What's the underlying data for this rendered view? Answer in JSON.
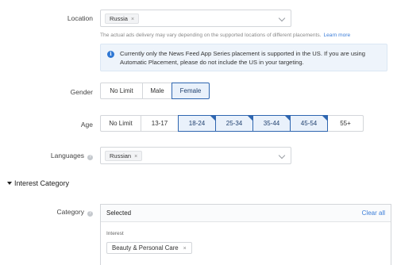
{
  "location": {
    "label": "Location",
    "chip": "Russia",
    "chip_remove": "×",
    "note": "The actual ads delivery may vary depending on the supported locations of different placements.",
    "note_link": "Learn more",
    "info_icon": "i",
    "info_text": "Currently only the News Feed App Series placement is supported in the US. If you are using Automatic Placement, please do not include the US in your targeting."
  },
  "gender": {
    "label": "Gender",
    "options": [
      "No Limit",
      "Male",
      "Female"
    ],
    "selected": "Female"
  },
  "age": {
    "label": "Age",
    "options": [
      "No Limit",
      "13-17",
      "18-24",
      "25-34",
      "35-44",
      "45-54",
      "55+"
    ],
    "selected": [
      "18-24",
      "25-34",
      "35-44",
      "45-54"
    ]
  },
  "languages": {
    "label": "Languages",
    "help_icon": "?",
    "chip": "Russian",
    "chip_remove": "×"
  },
  "interest_section": {
    "title": "Interest Category"
  },
  "category": {
    "label": "Category",
    "help_icon": "?",
    "header": "Selected",
    "clear_all": "Clear all",
    "sub_label": "Interest",
    "chip": "Beauty & Personal Care",
    "chip_remove": "×"
  },
  "colors": {
    "accent": "#2f66b0",
    "link": "#3b7dd8",
    "info_bg": "#eef4fb"
  }
}
